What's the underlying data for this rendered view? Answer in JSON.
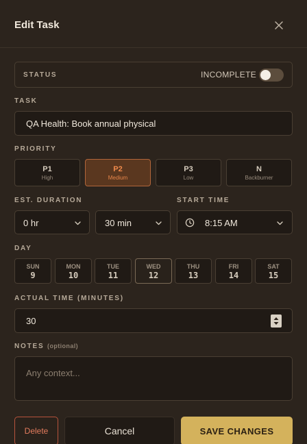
{
  "dialog": {
    "title": "Edit Task"
  },
  "status": {
    "label": "STATUS",
    "value": "INCOMPLETE",
    "toggle_on": false
  },
  "task": {
    "label": "TASK",
    "value": "QA Health: Book annual physical"
  },
  "priority": {
    "label": "PRIORITY",
    "selected": "P2",
    "options": [
      {
        "code": "P1",
        "name": "High"
      },
      {
        "code": "P2",
        "name": "Medium"
      },
      {
        "code": "P3",
        "name": "Low"
      },
      {
        "code": "N",
        "name": "Backburner"
      }
    ]
  },
  "duration": {
    "label": "EST. DURATION",
    "hours": "0 hr",
    "minutes": "30 min"
  },
  "start_time": {
    "label": "START TIME",
    "value": "8:15 AM"
  },
  "day": {
    "label": "DAY",
    "selected": "12",
    "days": [
      {
        "name": "SUN",
        "date": "9"
      },
      {
        "name": "MON",
        "date": "10"
      },
      {
        "name": "TUE",
        "date": "11"
      },
      {
        "name": "WED",
        "date": "12"
      },
      {
        "name": "THU",
        "date": "13"
      },
      {
        "name": "FRI",
        "date": "14"
      },
      {
        "name": "SAT",
        "date": "15"
      }
    ]
  },
  "actual_time": {
    "label": "ACTUAL TIME (MINUTES)",
    "value": "30"
  },
  "notes": {
    "label": "NOTES",
    "optional": "(optional)",
    "placeholder": "Any context..."
  },
  "buttons": {
    "delete": "Delete",
    "cancel": "Cancel",
    "save": "SAVE CHANGES"
  },
  "colors": {
    "accent": "#d4b25c",
    "priority_active": "#f08a4b",
    "danger": "#e47c5e"
  }
}
